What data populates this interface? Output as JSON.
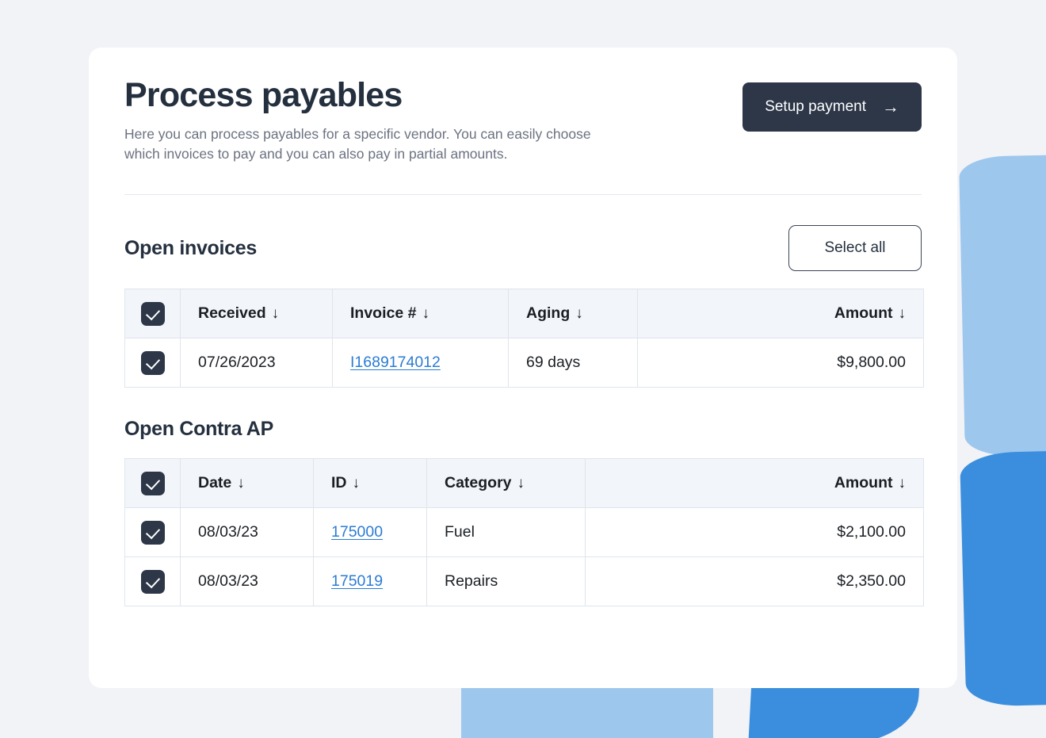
{
  "page": {
    "title": "Process payables",
    "description": "Here you can process payables for a specific vendor. You can easily choose which invoices to pay and you can also pay in partial amounts.",
    "setup_button_label": "Setup payment",
    "setup_button_icon": "arrow-right-icon",
    "arrow_glyph": "→"
  },
  "colors": {
    "page_background": "#f1f3f7",
    "card_background": "#ffffff",
    "primary_dark": "#2d3748",
    "link_blue": "#2b7cd3",
    "band_light_blue": "#9dc7ed",
    "band_blue": "#3b8ede",
    "table_header_bg": "#f2f5f9",
    "table_border": "#dfe5ec",
    "muted_text": "#6b7280"
  },
  "invoices_section": {
    "heading": "Open invoices",
    "select_all_label": "Select all",
    "sort_glyph": "↓",
    "columns": [
      {
        "key": "checkbox",
        "label": "",
        "align": "center",
        "sortable": false
      },
      {
        "key": "received",
        "label": "Received",
        "align": "left",
        "sortable": true
      },
      {
        "key": "invoice",
        "label": "Invoice #",
        "align": "left",
        "sortable": true
      },
      {
        "key": "aging",
        "label": "Aging",
        "align": "left",
        "sortable": true
      },
      {
        "key": "spacer",
        "label": "",
        "align": "left",
        "sortable": false
      },
      {
        "key": "amount",
        "label": "Amount",
        "align": "right",
        "sortable": true
      }
    ],
    "rows": [
      {
        "checked": true,
        "received": "07/26/2023",
        "invoice": "I1689174012",
        "aging": "69 days",
        "amount": "$9,800.00"
      }
    ],
    "header_checkbox_checked": true
  },
  "contra_ap_section": {
    "heading": "Open Contra AP",
    "sort_glyph": "↓",
    "columns": [
      {
        "key": "checkbox",
        "label": "",
        "align": "center",
        "sortable": false
      },
      {
        "key": "date",
        "label": "Date",
        "align": "left",
        "sortable": true
      },
      {
        "key": "id",
        "label": "ID",
        "align": "left",
        "sortable": true
      },
      {
        "key": "category",
        "label": "Category",
        "align": "left",
        "sortable": true
      },
      {
        "key": "spacer",
        "label": "",
        "align": "left",
        "sortable": false
      },
      {
        "key": "amount",
        "label": "Amount",
        "align": "right",
        "sortable": true
      }
    ],
    "rows": [
      {
        "checked": true,
        "date": "08/03/23",
        "id": "175000",
        "category": "Fuel",
        "amount": "$2,100.00"
      },
      {
        "checked": true,
        "date": "08/03/23",
        "id": "175019",
        "category": "Repairs",
        "amount": "$2,350.00"
      }
    ],
    "header_checkbox_checked": true
  }
}
